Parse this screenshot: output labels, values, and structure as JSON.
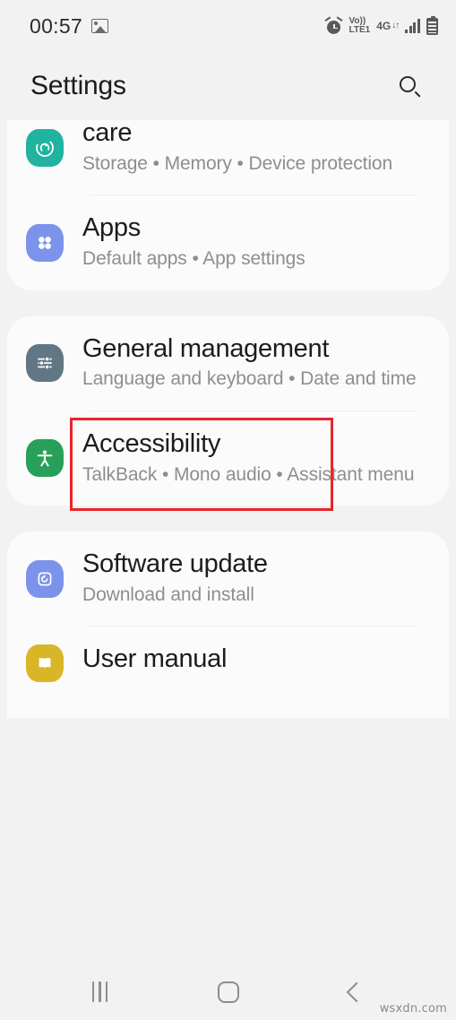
{
  "status_bar": {
    "clock": "00:57",
    "left_icons": [
      {
        "name": "photo-icon",
        "glyph": "image"
      }
    ],
    "right_icons": [
      {
        "name": "alarm-icon",
        "glyph": "alarm"
      },
      {
        "name": "volte-icon",
        "line1": "Vo))",
        "line2": "LTE1"
      },
      {
        "name": "network-4g-icon",
        "label": "4G",
        "arrows": "↓↑"
      },
      {
        "name": "signal-bars-icon",
        "bars": 4
      },
      {
        "name": "battery-icon",
        "glyph": "battery"
      }
    ]
  },
  "header": {
    "title": "Settings",
    "search_icon": "search-icon"
  },
  "cards": [
    {
      "clipped_top": true,
      "rows": [
        {
          "title": "care",
          "subtitle": "Storage  •  Memory  •  Device protection",
          "icon_name": "device-care-icon",
          "icon_color": "#21b3a0",
          "divider_after": true
        },
        {
          "title": "Apps",
          "subtitle": "Default apps  •  App settings",
          "icon_name": "apps-icon",
          "icon_color": "#7b93ea",
          "divider_after": false
        }
      ]
    },
    {
      "clipped_top": false,
      "rows": [
        {
          "title": "General management",
          "subtitle": "Language and keyboard  •  Date and time",
          "icon_name": "general-management-icon",
          "icon_color": "#627786",
          "divider_after": true,
          "highlighted": true
        },
        {
          "title": "Accessibility",
          "subtitle": "TalkBack  •  Mono audio  •  Assistant menu",
          "icon_name": "accessibility-icon",
          "icon_color": "#28a05a",
          "divider_after": false
        }
      ]
    },
    {
      "clipped_bottom": true,
      "rows": [
        {
          "title": "Software update",
          "subtitle": "Download and install",
          "icon_name": "software-update-icon",
          "icon_color": "#7b93ea",
          "divider_after": true
        },
        {
          "title": "User manual",
          "subtitle": "",
          "icon_name": "user-manual-icon",
          "icon_color": "#d9b628",
          "divider_after": false
        }
      ]
    }
  ],
  "annotation": {
    "color": "#e8252a",
    "target": "General management"
  },
  "nav_bar": {
    "recents_label": "recents-icon",
    "home_label": "home-icon",
    "back_label": "back-icon"
  },
  "watermark": "wsxdn.com"
}
